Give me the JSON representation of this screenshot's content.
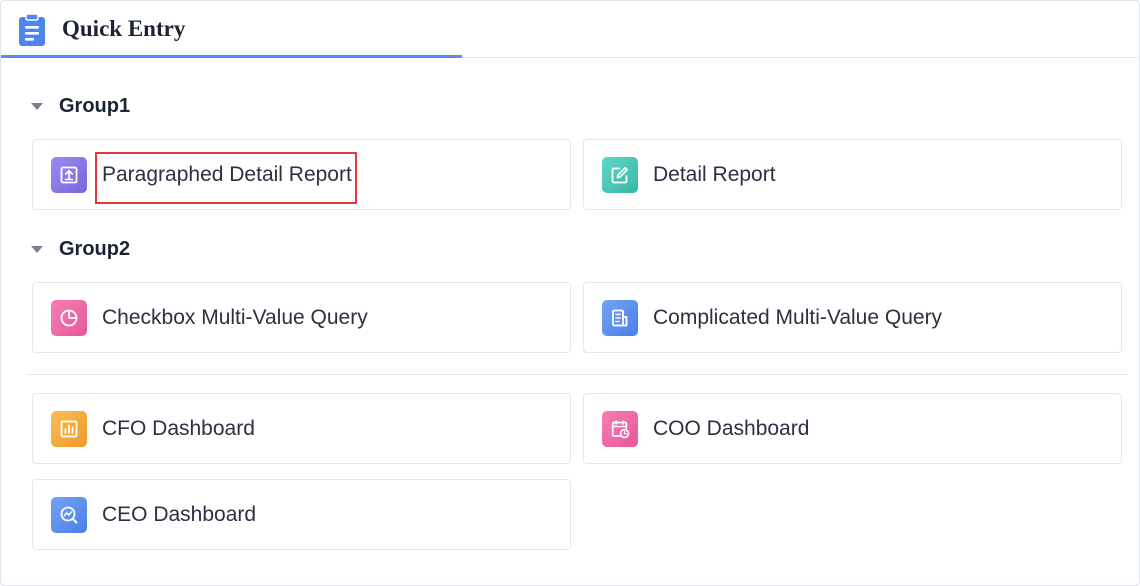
{
  "header": {
    "title": "Quick Entry",
    "icon": "clipboard-icon",
    "accent_color": "#5b8def"
  },
  "groups": [
    {
      "label": "Group1",
      "items": [
        {
          "label": "Paragraphed Detail Report",
          "icon": "upload-box-icon",
          "color": "#8a78e6",
          "highlighted": true
        },
        {
          "label": "Detail Report",
          "icon": "edit-icon",
          "color": "#45c8b4"
        }
      ]
    },
    {
      "label": "Group2",
      "items": [
        {
          "label": "Checkbox Multi-Value Query",
          "icon": "pie-chart-icon",
          "color": "#f06aa6"
        },
        {
          "label": "Complicated Multi-Value Query",
          "icon": "document-icon",
          "color": "#5b8def"
        }
      ]
    }
  ],
  "ungrouped": [
    {
      "label": "CFO Dashboard",
      "icon": "bar-chart-icon",
      "color": "#f5a93a"
    },
    {
      "label": "COO Dashboard",
      "icon": "calendar-clock-icon",
      "color": "#f06aa6"
    },
    {
      "label": "CEO Dashboard",
      "icon": "trend-search-icon",
      "color": "#5b8def"
    }
  ],
  "highlight_color": "#e0393e"
}
